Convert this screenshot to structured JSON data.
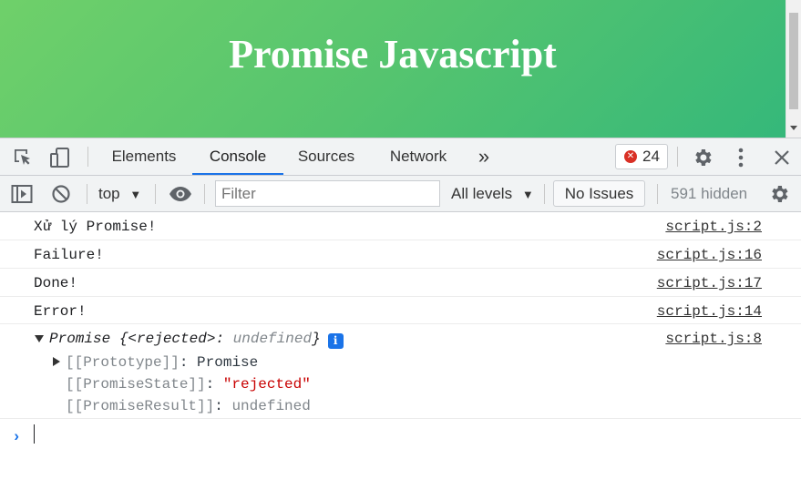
{
  "page": {
    "title": "Promise Javascript"
  },
  "devtools": {
    "tabs": [
      {
        "label": "Elements"
      },
      {
        "label": "Console"
      },
      {
        "label": "Sources"
      },
      {
        "label": "Network"
      }
    ],
    "more_tabs": "»",
    "error_count": "24",
    "icons": [
      "inspect-icon",
      "device-toggle-icon",
      "gear-icon",
      "kebab-menu-icon",
      "close-icon"
    ]
  },
  "toolbar": {
    "context": "top",
    "filter_placeholder": "Filter",
    "levels": "All levels",
    "issues": "No Issues",
    "hidden": "591 hidden"
  },
  "console": {
    "messages": [
      {
        "text": "Xử lý Promise!",
        "source": "script.js:2"
      },
      {
        "text": "Failure!",
        "source": "script.js:16"
      },
      {
        "text": "Done!",
        "source": "script.js:17"
      },
      {
        "text": "Error!",
        "source": "script.js:14"
      }
    ],
    "promise": {
      "head_name": "Promise ",
      "head_brace_open": "{",
      "head_key": "<rejected>",
      "head_colon": ": ",
      "head_value": "undefined",
      "head_brace_close": "}",
      "info": "i",
      "source": "script.js:8",
      "prototype_key": "[[Prototype]]",
      "prototype_value": "Promise",
      "state_key": "[[PromiseState]]",
      "state_value": "\"rejected\"",
      "result_key": "[[PromiseResult]]",
      "result_value": "undefined",
      "sep": ": "
    }
  },
  "colors": {
    "accent": "#1a73e8",
    "error": "#d93025",
    "string": "#c80000"
  }
}
